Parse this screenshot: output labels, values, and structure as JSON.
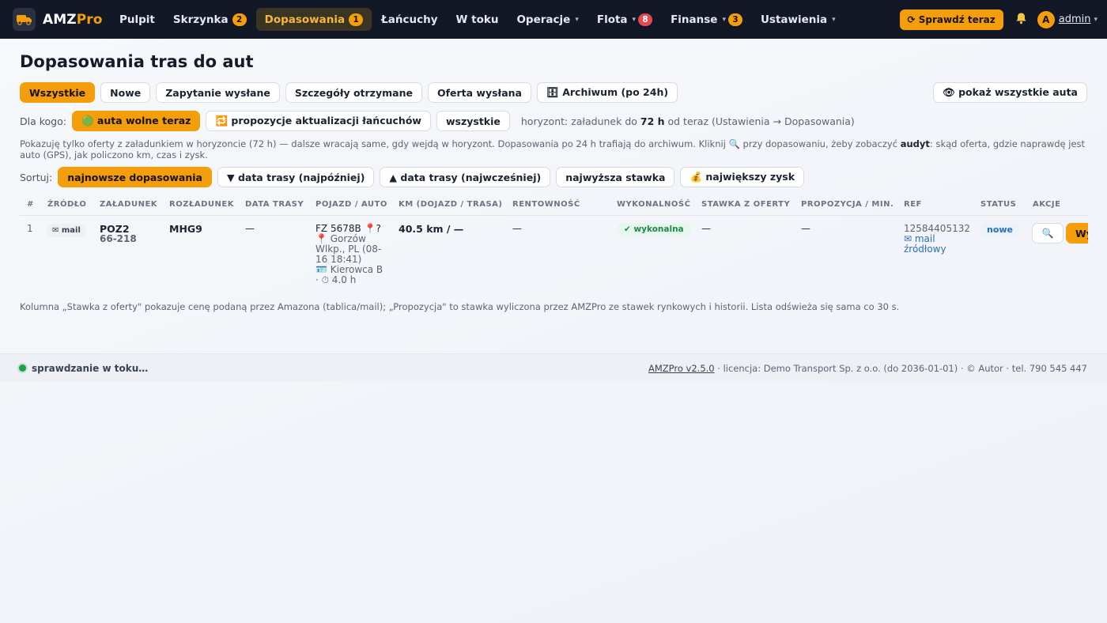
{
  "brand": {
    "name_main": "AMZ",
    "name_accent": "Pro"
  },
  "nav": [
    {
      "label": "Pulpit"
    },
    {
      "label": "Skrzynka",
      "badge": "2"
    },
    {
      "label": "Dopasowania",
      "badge": "1",
      "active": true
    },
    {
      "label": "Łańcuchy"
    },
    {
      "label": "W toku"
    },
    {
      "label": "Operacje",
      "caret": "▾"
    },
    {
      "label": "Flota",
      "caret": "▾",
      "badge": "8"
    },
    {
      "label": "Finanse",
      "caret": "▾",
      "badge": "3"
    },
    {
      "label": "Ustawienia",
      "caret": "▾"
    }
  ],
  "top_right": {
    "check_now": "⟳ Sprawdź teraz",
    "avatar_letter": "A",
    "user_name": "admin",
    "user_caret": "▾"
  },
  "page": {
    "title": "Dopasowania tras do aut"
  },
  "filters": {
    "tabs": [
      "Wszystkie",
      "Nowe",
      "Zapytanie wysłane",
      "Szczegóły otrzymane",
      "Oferta wysłana",
      "🗄 Archiwum (po 24h)"
    ],
    "show_all": "👁 pokaż wszystkie auta",
    "for_label": "Dla kogo:",
    "for_options": [
      "🟢 auta wolne teraz",
      "🔁 propozycje aktualizacji łańcuchów",
      "wszystkie"
    ],
    "horizon_prefix": "horyzont: załadunek do ",
    "horizon_value": "72 h",
    "horizon_suffix": " od teraz (Ustawienia → Dopasowania)",
    "info_part1": "Pokazuję tylko oferty z załadunkiem w horyzoncie (72 h) — dalsze wracają same, gdy wejdą w horyzont. Dopasowania po 24 h trafiają do archiwum. Kliknij 🔍 przy dopasowaniu, żeby zobaczyć ",
    "info_bold": "audyt",
    "info_part2": ": skąd oferta, gdzie naprawdę jest auto (GPS), jak policzono km, czas i zysk.",
    "sort_label": "Sortuj:",
    "sort_options": [
      "najnowsze dopasowania",
      "▼ data trasy (najpóźniej)",
      "▲ data trasy (najwcześniej)",
      "najwyższa stawka",
      "💰 największy zysk"
    ]
  },
  "table": {
    "headers": [
      "#",
      "Źródło",
      "Załadunek",
      "Rozładunek",
      "Data trasy",
      "Pojazd / auto",
      "Km (dojazd / trasa)",
      "Rentowność",
      "Wykonalność",
      "Stawka z oferty",
      "Propozycja / min.",
      "Ref",
      "Status",
      "Akcje"
    ],
    "rows": [
      {
        "num": "1",
        "source": "✉ mail",
        "load_code": "POZ2",
        "load_zip": "66-218",
        "unload_code": "MHG9",
        "route_date": "—",
        "vehicle_plate": "FZ 5678B 📍?",
        "vehicle_loc": "📍 Gorzów Wlkp., PL (08-16 18:41)",
        "vehicle_driver": "🪪 Kierowca B · ⏱ 4.0 h",
        "km": "40.5 km / —",
        "profit": "—",
        "feasibility": "✔ wykonalna",
        "offer_rate": "—",
        "proposal": "—",
        "ref": "12584405132",
        "ref_link": "✉ mail źródłowy",
        "status": "nowe",
        "audit": "🔍",
        "send": "Wyślij"
      }
    ]
  },
  "note": "Kolumna „Stawka z oferty\" pokazuje cenę podaną przez Amazona (tablica/mail); „Propozycja\" to stawka wyliczona przez AMZPro ze stawek rynkowych i historii. Lista odświeża się sama co 30 s.",
  "footer": {
    "checking": "sprawdzanie w toku…",
    "version": "AMZPro v2.5.0",
    "rest": " · licencja: Demo Transport Sp. z o.o. (do 2036-01-01) · © Autor · tel. 790 545 447"
  },
  "colors": {
    "accent": "#f59e0b",
    "topbar": "#121826",
    "danger": "#e5484d",
    "success": "#1e8a47"
  },
  "icons": {
    "brand": "truck-icon",
    "bell": "bell-icon",
    "audit": "magnifier-icon"
  }
}
